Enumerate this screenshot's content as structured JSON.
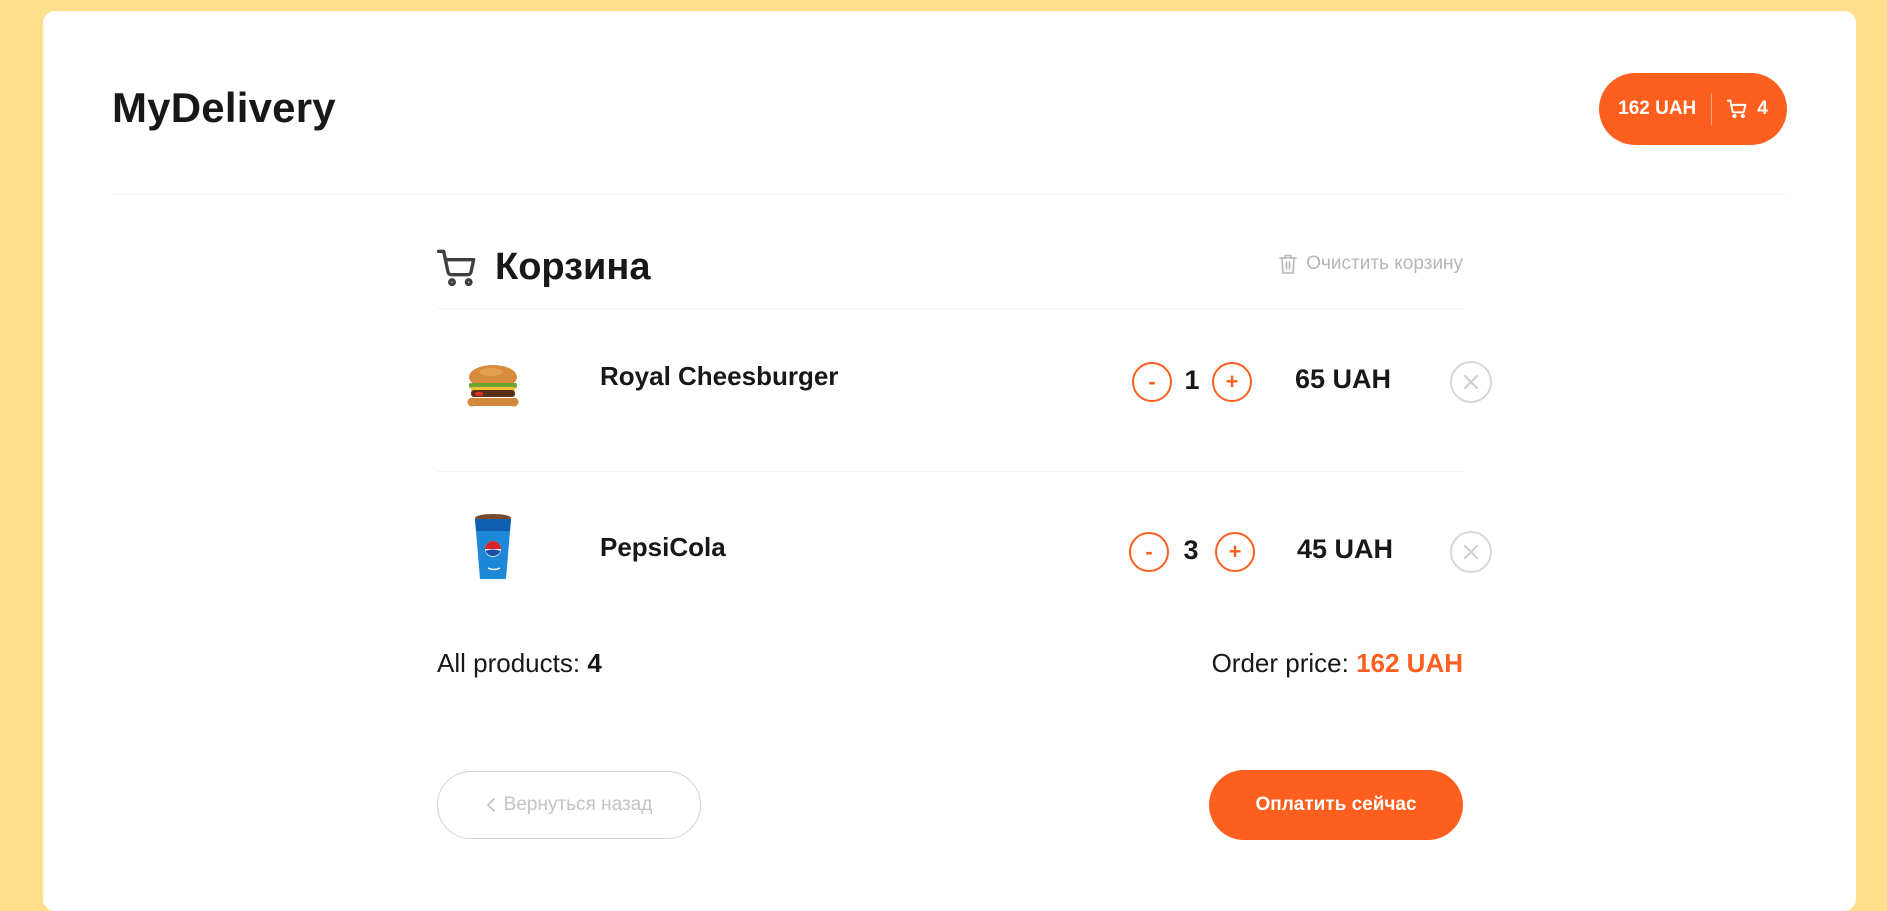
{
  "header": {
    "logo": "MyDelivery",
    "cart_button": {
      "price": "162 UAH",
      "count": "4"
    }
  },
  "cart": {
    "title": "Корзина",
    "clear_label": "Очистить корзину",
    "items": [
      {
        "name": "Royal Cheesburger",
        "minus": "-",
        "quantity": "1",
        "plus": "+",
        "price": "65 UAH",
        "image": "cheeseburger-image"
      },
      {
        "name": "PepsiCola",
        "minus": "-",
        "quantity": "3",
        "plus": "+",
        "price": "45 UAH",
        "image": "pepsi-cup-image"
      }
    ],
    "summary": {
      "count_label": "All products:",
      "count_value": "4",
      "price_label": "Order price:",
      "price_value": "162 UAH"
    },
    "back_label": "Вернуться назад",
    "pay_label": "Оплатить сейчас"
  },
  "colors": {
    "accent": "#fe5f1e",
    "background": "#ffdf8c",
    "muted": "#b6b6b6"
  }
}
